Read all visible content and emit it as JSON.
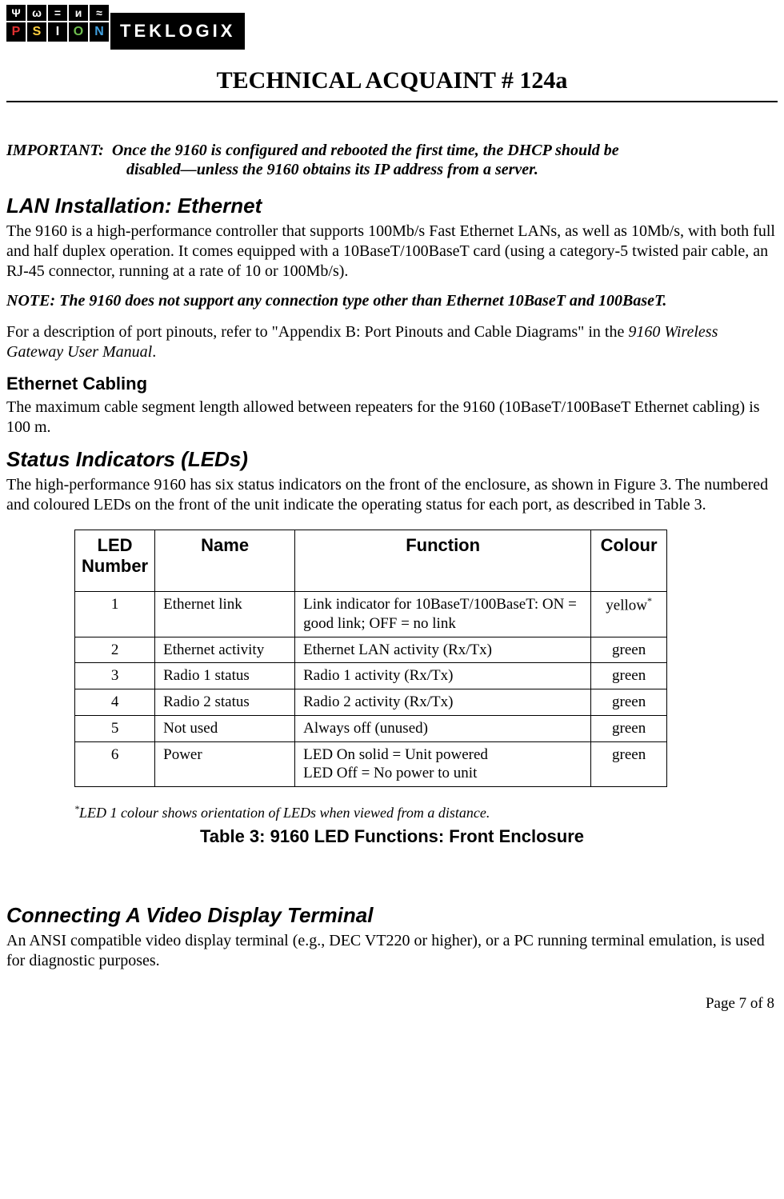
{
  "logo": {
    "brand": "PSION",
    "sub": "TEKLOGIX"
  },
  "title": "TECHNICAL ACQUAINT # 124a",
  "important": {
    "label": "IMPORTANT:",
    "line1": "Once the 9160 is configured and rebooted the first time, the DHCP should be",
    "line2": "disabled—unless the 9160 obtains its IP address from a server."
  },
  "sec1": {
    "heading": "LAN Installation: Ethernet",
    "p1": "The 9160 is a high-performance controller that supports 100Mb/s Fast Ethernet LANs, as well as 10Mb/s, with both full and half duplex operation. It comes equipped with a 10BaseT/100BaseT card (using a category-5 twisted pair cable, an RJ-45 connector, running at a rate of 10 or 100Mb/s).",
    "note": "NOTE: The 9160 does not support any connection type other than Ethernet 10BaseT and 100BaseT.",
    "p2a": "For a description of port pinouts, refer to \"Appendix B: Port Pinouts and Cable Diagrams\" in the ",
    "p2i": "9160 Wireless Gateway User Manual",
    "p2b": "."
  },
  "sec2": {
    "heading": "Ethernet Cabling",
    "p1": "The maximum cable segment length allowed between repeaters for the 9160 (10BaseT/100BaseT Ethernet cabling) is 100 m."
  },
  "sec3": {
    "heading": "Status Indicators (LEDs)",
    "p1": "The high-performance 9160 has six status indicators on the front of the enclosure, as shown in Figure 3. The numbered and coloured LEDs on the front of the unit indicate the operating status for each port, as described in Table 3."
  },
  "table": {
    "head": {
      "c0": "LED Number",
      "c1": "Name",
      "c2": "Function",
      "c3": "Colour"
    },
    "rows": [
      {
        "num": "1",
        "name": "Ethernet link",
        "func": "Link indicator for 10BaseT/100BaseT: ON = good link; OFF = no link",
        "colour": "yellow",
        "sup": "*"
      },
      {
        "num": "2",
        "name": "Ethernet activity",
        "func": "Ethernet LAN activity (Rx/Tx)",
        "colour": "green"
      },
      {
        "num": "3",
        "name": "Radio 1 status",
        "func": "Radio 1 activity (Rx/Tx)",
        "colour": "green"
      },
      {
        "num": "4",
        "name": "Radio 2 status",
        "func": "Radio 2 activity (Rx/Tx)",
        "colour": "green"
      },
      {
        "num": "5",
        "name": "Not used",
        "func": "Always off (unused)",
        "colour": "green"
      },
      {
        "num": "6",
        "name": "Power",
        "func": "LED On solid = Unit powered\nLED Off = No power to unit",
        "colour": "green"
      }
    ],
    "footnote": "LED 1 colour shows orientation of LEDs when viewed from a distance.",
    "caption": "Table 3: 9160 LED Functions: Front Enclosure"
  },
  "sec4": {
    "heading": "Connecting A Video Display Terminal",
    "p1": "An ANSI compatible video display terminal (e.g., DEC VT220 or higher), or a PC running terminal emulation, is used for diagnostic purposes."
  },
  "pagefoot": "Page 7 of 8"
}
